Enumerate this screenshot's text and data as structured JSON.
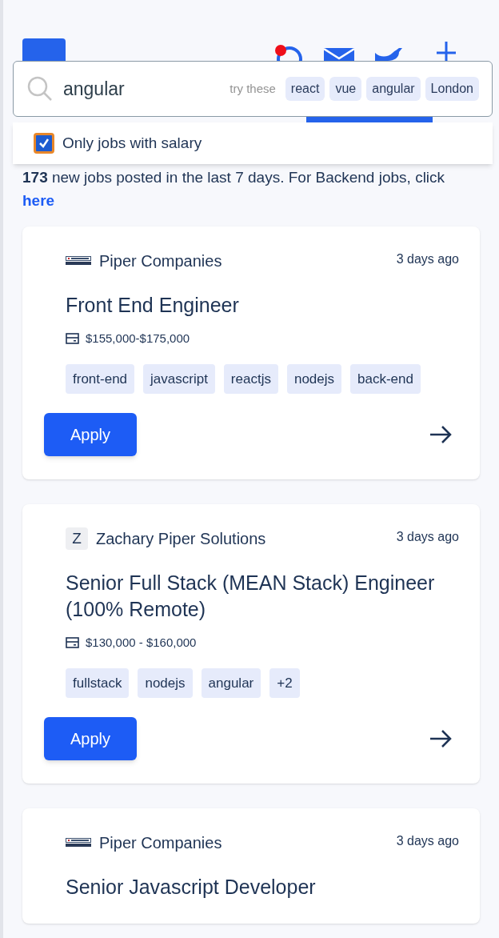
{
  "search": {
    "value": "angular",
    "hint_label": "try these",
    "suggestions": [
      "react",
      "vue",
      "angular",
      "London"
    ]
  },
  "salary_filter": {
    "label": "Only jobs with salary",
    "checked": true
  },
  "summary": {
    "text": "**173** new jobs posted in the last 7 days. For Backend jobs, click",
    "link": "here"
  },
  "jobs": [
    {
      "company": "Piper Companies",
      "logo": {
        "kind": "image"
      },
      "posted": "3 days ago",
      "title": "Front End Engineer",
      "salary": "$155,000-$175,000",
      "tags": [
        "front-end",
        "javascript",
        "reactjs",
        "nodejs",
        "back-end"
      ],
      "apply": "Apply"
    },
    {
      "company": "Zachary Piper Solutions",
      "logo": {
        "kind": "letter",
        "letter": "Z"
      },
      "posted": "3 days ago",
      "title": "Senior Full Stack (MEAN Stack) Engineer (100% Remote)",
      "salary": "$130,000 - $160,000",
      "tags": [
        "fullstack",
        "nodejs",
        "angular",
        "+2"
      ],
      "apply": "Apply"
    },
    {
      "company": "Piper Companies",
      "logo": {
        "kind": "image"
      },
      "posted": "3 days ago",
      "title": "Senior Javascript Developer"
    }
  ]
}
